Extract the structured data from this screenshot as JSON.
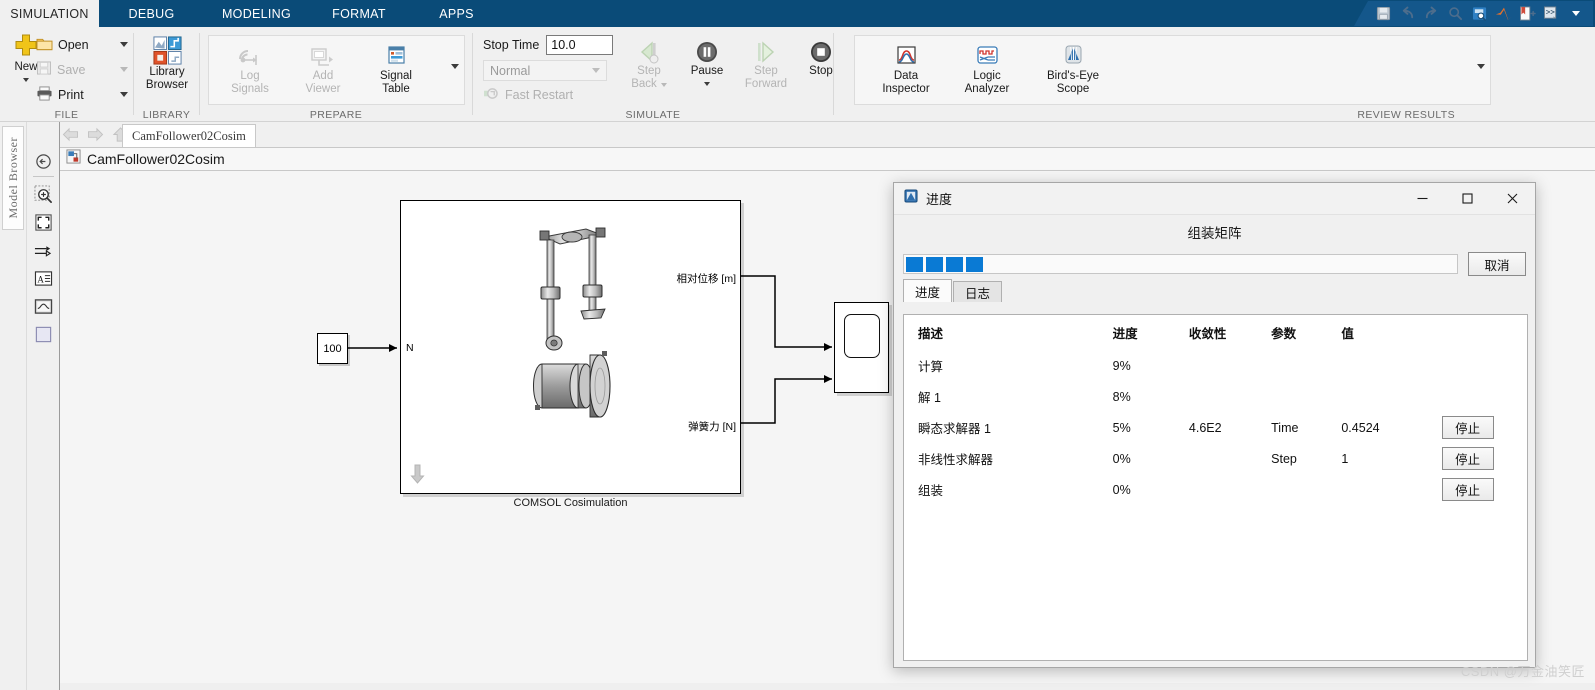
{
  "ribbon_tabs": [
    {
      "label": "SIMULATION",
      "active": true
    },
    {
      "label": "DEBUG",
      "active": false
    },
    {
      "label": "MODELING",
      "active": false
    },
    {
      "label": "FORMAT",
      "active": false
    },
    {
      "label": "APPS",
      "active": false
    }
  ],
  "quick_access": [
    {
      "name": "save-icon"
    },
    {
      "name": "undo-icon"
    },
    {
      "name": "redo-icon"
    },
    {
      "name": "search-icon"
    },
    {
      "name": "find-in-model-icon"
    },
    {
      "name": "matlab-logo-icon"
    },
    {
      "name": "simulink-help-icon"
    },
    {
      "name": "command-window-icon"
    },
    {
      "name": "quick-access-overflow-icon"
    }
  ],
  "groups": {
    "file": {
      "label": "FILE",
      "new_label": "New",
      "open_label": "Open",
      "save_label": "Save",
      "print_label": "Print"
    },
    "library": {
      "label": "LIBRARY",
      "browser_label_line1": "Library",
      "browser_label_line2": "Browser"
    },
    "prepare": {
      "label": "PREPARE",
      "items": [
        {
          "line1": "Log",
          "line2": "Signals",
          "disabled": true,
          "icon": "log-signals-icon"
        },
        {
          "line1": "Add",
          "line2": "Viewer",
          "disabled": true,
          "icon": "add-viewer-icon"
        },
        {
          "line1": "Signal",
          "line2": "Table",
          "disabled": false,
          "icon": "signal-table-icon"
        }
      ]
    },
    "simulate": {
      "label": "SIMULATE",
      "stop_time_label": "Stop Time",
      "stop_time_value": "10.0",
      "mode_value": "Normal",
      "fast_restart_label": "Fast Restart",
      "items": [
        {
          "line1": "Step",
          "line2": "Back",
          "disabled": true,
          "caret": true,
          "icon": "step-back-icon"
        },
        {
          "line1": "Pause",
          "line2": "",
          "disabled": false,
          "caret": true,
          "icon": "pause-icon"
        },
        {
          "line1": "Step",
          "line2": "Forward",
          "disabled": true,
          "caret": false,
          "icon": "step-forward-icon"
        },
        {
          "line1": "Stop",
          "line2": "",
          "disabled": false,
          "caret": false,
          "icon": "stop-icon"
        }
      ]
    },
    "review": {
      "label": "REVIEW RESULTS",
      "items": [
        {
          "line1": "Data",
          "line2": "Inspector",
          "icon": "data-inspector-icon"
        },
        {
          "line1": "Logic",
          "line2": "Analyzer",
          "icon": "logic-analyzer-icon"
        },
        {
          "line1": "Bird's-Eye",
          "line2": "Scope",
          "icon": "birds-eye-scope-icon"
        }
      ]
    }
  },
  "model_browser": {
    "label": "Model Browser"
  },
  "nav_tools": [
    {
      "name": "navigate-back-icon"
    },
    {
      "name": "zoom-in-icon"
    },
    {
      "name": "fit-to-view-icon"
    },
    {
      "name": "signal-routing-icon"
    },
    {
      "name": "annotation-icon"
    },
    {
      "name": "scope-tool-icon"
    },
    {
      "name": "block-tool-icon"
    }
  ],
  "document": {
    "tab_label": "CamFollower02Cosim",
    "breadcrumb_label": "CamFollower02Cosim"
  },
  "diagram": {
    "constant_value": "100",
    "input_port_label": "N",
    "output_port_1": "相对位移 [m]",
    "output_port_2": "弹簧力 [N]",
    "subsystem_caption": "COMSOL Cosimulation"
  },
  "dialog": {
    "title": "进度",
    "heading": "组装矩阵",
    "progress_blocks": 4,
    "cancel_label": "取消",
    "minimize_label": "—",
    "maximize_label": "☐",
    "close_label": "✕",
    "tabs": [
      {
        "label": "进度",
        "active": true
      },
      {
        "label": "日志",
        "active": false
      }
    ],
    "table": {
      "headers": [
        "描述",
        "进度",
        "收敛性",
        "参数",
        "值",
        ""
      ],
      "rows": [
        {
          "desc": "计算",
          "progress": "9%",
          "convergence": "",
          "param": "",
          "value": "",
          "action": ""
        },
        {
          "desc": "解 1",
          "progress": "8%",
          "convergence": "",
          "param": "",
          "value": "",
          "action": ""
        },
        {
          "desc": "瞬态求解器 1",
          "progress": "5%",
          "convergence": "4.6E2",
          "param": "Time",
          "value": "0.4524",
          "action": "停止"
        },
        {
          "desc": "非线性求解器",
          "progress": "0%",
          "convergence": "",
          "param": "Step",
          "value": "1",
          "action": "停止"
        },
        {
          "desc": "组装",
          "progress": "0%",
          "convergence": "",
          "param": "",
          "value": "",
          "action": "停止"
        }
      ]
    }
  },
  "watermark": "CSDN @万金油笑匠",
  "colors": {
    "ribbon_blue": "#0a4b78",
    "progress_blue": "#0a7ad4",
    "panel_bg": "#f0f0f0"
  }
}
